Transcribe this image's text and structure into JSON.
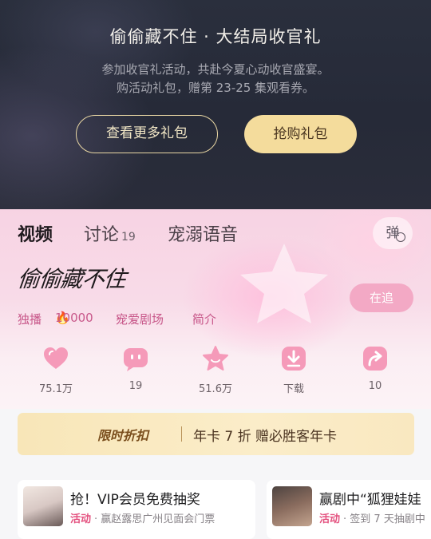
{
  "promo": {
    "title": "偷偷藏不住 · 大结局收官礼",
    "line1": "参加收官礼活动，共赴今夏心动收官盛宴。",
    "line2": "购活动礼包，赠第 23-25 集观看券。",
    "more_button": "查看更多礼包",
    "buy_button": "抢购礼包"
  },
  "tabs": [
    {
      "label": "视频",
      "active": true
    },
    {
      "label": "讨论",
      "count": "19"
    },
    {
      "label": "宠溺语音"
    }
  ],
  "danmu_label": "弹",
  "show": {
    "logo_text": "偷偷藏不住",
    "follow_label": "在追",
    "meta": {
      "exclusive": "独播",
      "heat": "10000",
      "category": "宠爱剧场",
      "intro": "简介"
    }
  },
  "actions": [
    {
      "icon": "heart-icon",
      "label": "75.1万"
    },
    {
      "icon": "comment-icon",
      "label": "19"
    },
    {
      "icon": "star-icon",
      "label": "51.6万"
    },
    {
      "icon": "download-icon",
      "label": "下载"
    },
    {
      "icon": "share-icon",
      "label": "10"
    }
  ],
  "discount": {
    "tag": "限时折扣",
    "text": "年卡 7 折 赠必胜客年卡"
  },
  "cards": [
    {
      "title": "抢！VIP会员免费抽奖",
      "badge": "活动",
      "desc": "· 赢赵露思广州见面会门票"
    },
    {
      "title": "赢剧中“狐狸娃娃",
      "badge": "活动",
      "desc": "· 签到 7 天抽剧中"
    }
  ],
  "colors": {
    "accent_pink": "#f3a9c5",
    "icon_pink": "#f59ab9",
    "gold": "#f4dc9c"
  }
}
